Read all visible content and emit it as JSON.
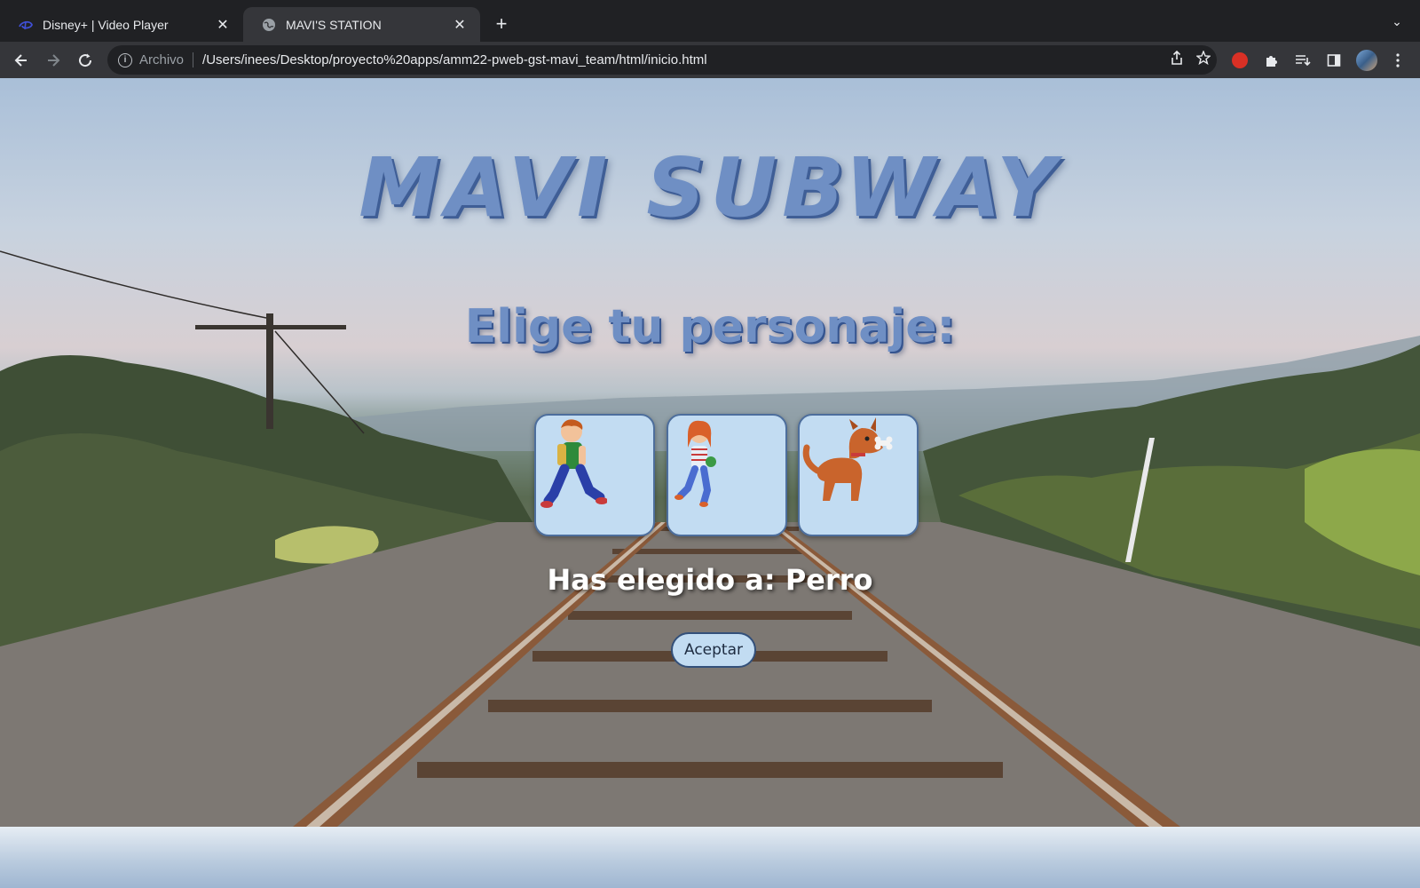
{
  "browser": {
    "tabs": [
      {
        "title": "Disney+ | Video Player",
        "active": false,
        "favicon": "disney-plus-icon"
      },
      {
        "title": "MAVI'S STATION",
        "active": true,
        "favicon": "globe-icon"
      }
    ],
    "close_glyph": "✕",
    "new_tab_glyph": "+",
    "tab_search_glyph": "⌄",
    "address": {
      "scheme_label": "Archivo",
      "url": "/Users/inees/Desktop/proyecto%20apps/amm22-pweb-gst-mavi_team/html/inicio.html"
    },
    "colors": {
      "chrome_dark": "#202124",
      "chrome_toolbar": "#35363a"
    }
  },
  "page": {
    "title": "MAVI SUBWAY",
    "subtitle": "Elige tu personaje:",
    "characters": [
      {
        "name": "boy-character",
        "icon": "running-boy-icon"
      },
      {
        "name": "girl-character",
        "icon": "running-girl-icon"
      },
      {
        "name": "dog-character",
        "icon": "dog-with-bone-icon"
      }
    ],
    "selection_text": "Has elegido a: Perro",
    "accept_label": "Aceptar",
    "colors": {
      "title": "#6f8fc4",
      "title_shadow": "#3f5e96",
      "card_bg": "#c2dcf2",
      "card_border": "#4d6e9c"
    }
  }
}
